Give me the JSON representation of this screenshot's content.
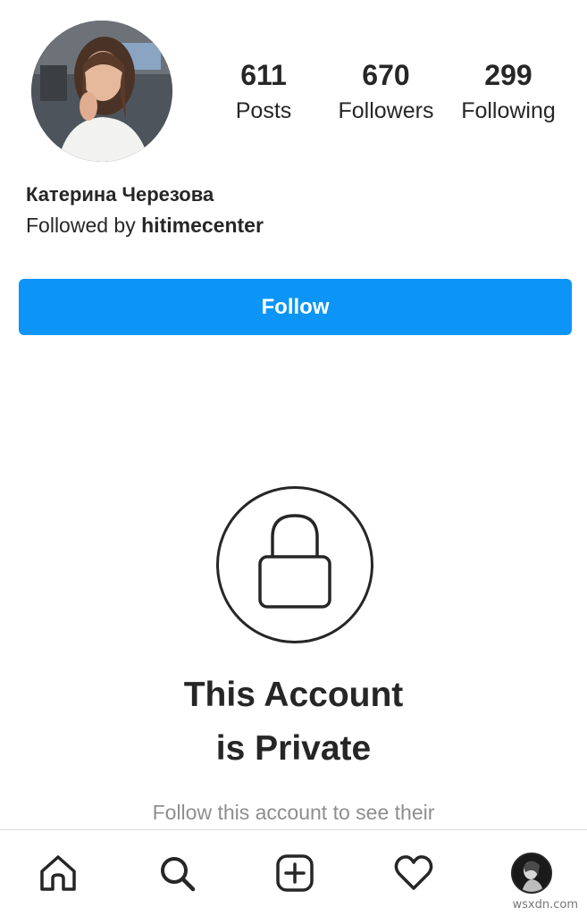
{
  "profile": {
    "display_name": "Катерина Черезова",
    "followed_by_prefix": "Followed by",
    "followed_by_user": "hitimecenter",
    "stats": {
      "posts": {
        "value": "611",
        "label": "Posts"
      },
      "followers": {
        "value": "670",
        "label": "Followers"
      },
      "following": {
        "value": "299",
        "label": "Following"
      }
    },
    "follow_button_label": "Follow"
  },
  "private_notice": {
    "title_line1": "This Account",
    "title_line2": "is Private",
    "subtitle": "Follow this account to see their",
    "icon": "lock-icon"
  },
  "bottom_nav": {
    "items": [
      {
        "name": "home",
        "icon": "home-icon"
      },
      {
        "name": "search",
        "icon": "search-icon"
      },
      {
        "name": "new-post",
        "icon": "add-icon"
      },
      {
        "name": "activity",
        "icon": "heart-icon"
      },
      {
        "name": "profile",
        "icon": "avatar"
      }
    ]
  },
  "watermark": "wsxdn.com",
  "colors": {
    "follow_button": "#0c95f6",
    "text_primary": "#262626",
    "text_secondary": "#8e8e8e",
    "divider": "#dbdbdb"
  }
}
